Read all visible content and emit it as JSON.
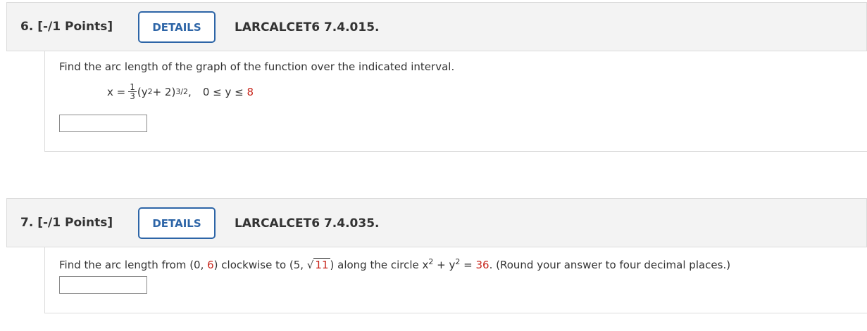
{
  "questions": [
    {
      "number": "6.",
      "points": "[-/1 Points]",
      "details_label": "DETAILS",
      "reference": "LARCALCET6 7.4.015.",
      "prompt": "Find the arc length of the graph of the function over the indicated interval.",
      "equation": {
        "lhs": "x =",
        "frac_num": "1",
        "frac_den": "3",
        "base": "(y",
        "exp1": "2",
        "mid": " + 2)",
        "exp2": "3/2",
        "comma": ",",
        "interval_prefix": "0 ≤ y ≤ ",
        "interval_upper": "8"
      },
      "answer_value": ""
    },
    {
      "number": "7.",
      "points": "[-/1 Points]",
      "details_label": "DETAILS",
      "reference": "LARCALCET6 7.4.035.",
      "prompt_parts": {
        "t1": "Find the arc length from ",
        "p1_open": "(0, ",
        "p1_y": "6",
        "p1_close": ")",
        "t2": " clockwise to ",
        "p2_open": "(5, ",
        "p2_rad": "11",
        "p2_close": ")",
        "t3": " along the circle ",
        "circle_x": "x",
        "circle_exp1": "2",
        "circle_plus": " + ",
        "circle_y": "y",
        "circle_exp2": "2",
        "circle_eq": " = ",
        "circle_r2": "36",
        "t4": ". (Round your answer to four decimal places.)"
      },
      "answer_value": ""
    }
  ],
  "colors": {
    "accent": "#2d65a7",
    "red_value": "#c8281e",
    "header_bg": "#f3f3f3"
  }
}
